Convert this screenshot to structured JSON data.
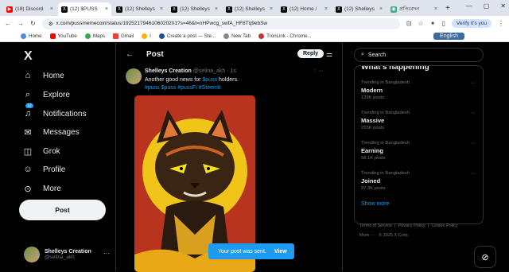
{
  "browser": {
    "tabs": [
      {
        "icon": "youtube-icon",
        "label": "(18) Discord",
        "color": "#ff0000",
        "active": false
      },
      {
        "icon": "x-icon",
        "label": "(12) $PUSS",
        "active": true
      },
      {
        "icon": "x-icon",
        "label": "(12) Shelleys",
        "active": false
      },
      {
        "icon": "x-icon",
        "label": "(12) Shelleys",
        "active": false
      },
      {
        "icon": "x-icon",
        "label": "(12) Shelleys",
        "active": false
      },
      {
        "icon": "x-icon",
        "label": "(12) Home /",
        "active": false
      },
      {
        "icon": "x-icon",
        "label": "(12) Shelleys",
        "active": false
      },
      {
        "icon": "globe-icon",
        "label": "প্রতিবেদন",
        "active": false
      }
    ],
    "url": "x.com/pussmemecoin/status/1925217946106020201?s=46&t=nHPwcg_swfA_HF8Tq9ebSw",
    "verify": "Verify it's you",
    "language": "English",
    "bookmarks": [
      "Home",
      "YouTube",
      "Maps",
      "Gmail",
      "I",
      "Create a post — Ste...",
      "New Tab",
      "TronLink - Chrome..."
    ]
  },
  "nav": {
    "items": [
      "Home",
      "Explore",
      "Notifications",
      "Messages",
      "Grok",
      "Profile",
      "More"
    ],
    "notif_count": "12",
    "post_button": "Post",
    "account": {
      "name": "Shelleys Creation",
      "handle": "@selina_akh"
    }
  },
  "main": {
    "title": "Post",
    "reply_button": "Reply",
    "tweet": {
      "name": "Shelleys Creation",
      "handle": "@selina_akh · 1s",
      "text": "Another good news for ",
      "cashtag": "$puss",
      "text_after": " holders.",
      "tags": "#puss $puss #pussFi #Steemit"
    },
    "toast": {
      "text": "Your post was sent.",
      "action": "View"
    }
  },
  "right": {
    "search_placeholder": "Search",
    "trends_title": "What's happening",
    "trends": [
      {
        "context": "Trending in Bangladesh",
        "name": "Modern",
        "count": "129K posts"
      },
      {
        "context": "Trending in Bangladesh",
        "name": "Massive",
        "count": "255K posts"
      },
      {
        "context": "Trending in Bangladesh",
        "name": "Earning",
        "count": "58.1K posts"
      },
      {
        "context": "Trending in Bangladesh",
        "name": "Joined",
        "count": "97.3K posts"
      }
    ],
    "show_more": "Show more",
    "footer": [
      "Terms of Service",
      "Privacy Policy",
      "Cookie Policy",
      "More ···",
      "© 2025 X Corp."
    ]
  }
}
